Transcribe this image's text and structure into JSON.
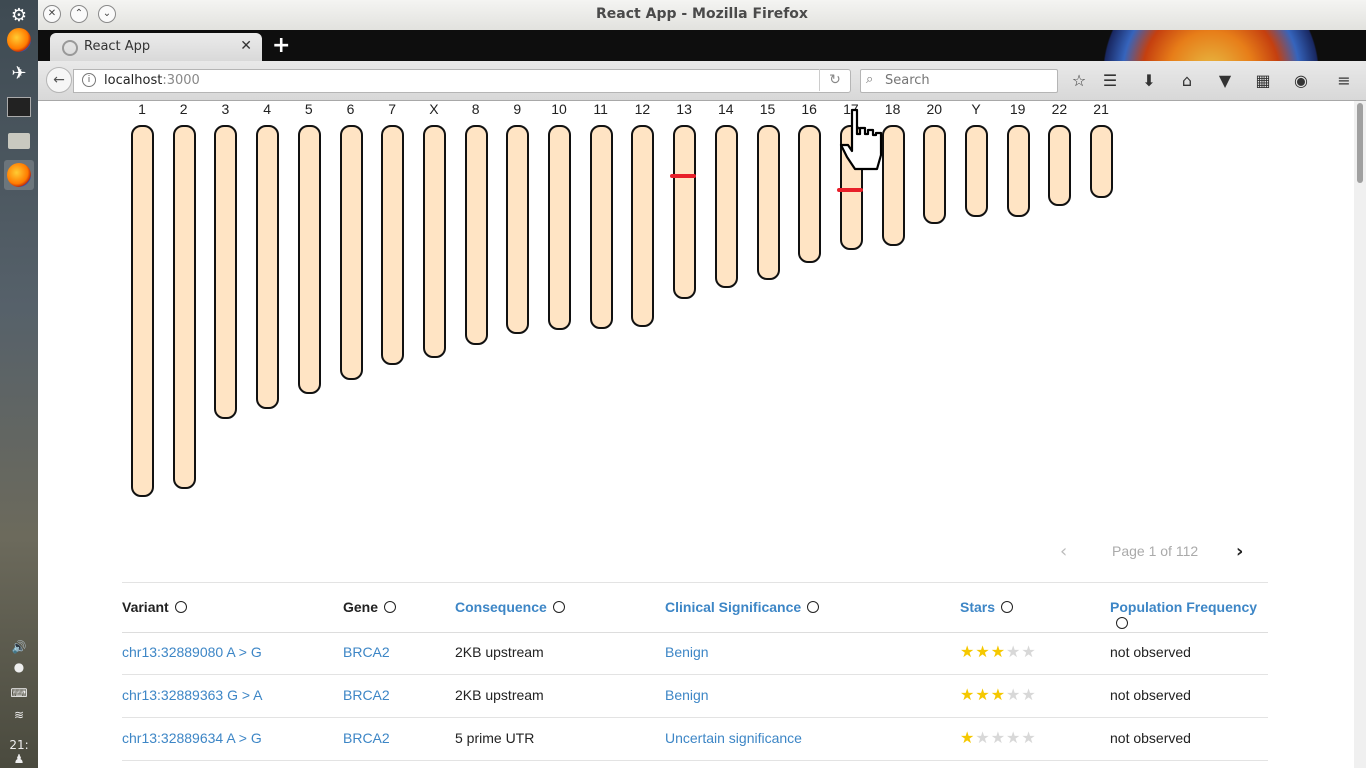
{
  "window": {
    "title": "React App - Mozilla Firefox"
  },
  "tab": {
    "label": "React App"
  },
  "address": {
    "host": "localhost",
    "port": ":3000"
  },
  "search": {
    "placeholder": "Search"
  },
  "system": {
    "clock": "21:"
  },
  "ideogram": {
    "chromosomes": [
      {
        "label": "1",
        "rel": 1.0
      },
      {
        "label": "2",
        "rel": 0.977
      },
      {
        "label": "3",
        "rel": 0.789
      },
      {
        "label": "4",
        "rel": 0.762
      },
      {
        "label": "5",
        "rel": 0.721
      },
      {
        "label": "6",
        "rel": 0.683
      },
      {
        "label": "7",
        "rel": 0.64
      },
      {
        "label": "X",
        "rel": 0.623
      },
      {
        "label": "8",
        "rel": 0.586
      },
      {
        "label": "9",
        "rel": 0.556
      },
      {
        "label": "10",
        "rel": 0.545
      },
      {
        "label": "11",
        "rel": 0.543
      },
      {
        "label": "12",
        "rel": 0.537
      },
      {
        "label": "13",
        "rel": 0.463,
        "mark": 0.29
      },
      {
        "label": "14",
        "rel": 0.431
      },
      {
        "label": "15",
        "rel": 0.409
      },
      {
        "label": "16",
        "rel": 0.365
      },
      {
        "label": "17",
        "rel": 0.328,
        "mark": 0.52
      },
      {
        "label": "18",
        "rel": 0.317
      },
      {
        "label": "20",
        "rel": 0.257
      },
      {
        "label": "Y",
        "rel": 0.24
      },
      {
        "label": "19",
        "rel": 0.238
      },
      {
        "label": "22",
        "rel": 0.208
      },
      {
        "label": "21",
        "rel": 0.188
      }
    ]
  },
  "pagination": {
    "text": "Page 1 of 112"
  },
  "table": {
    "headers": [
      "Variant",
      "Gene",
      "Consequence",
      "Clinical Significance",
      "Stars",
      "Population Frequency"
    ],
    "rows": [
      {
        "variant": "chr13:32889080 A > G",
        "gene": "BRCA2",
        "consequence": "2KB upstream",
        "significance": "Benign",
        "stars": 3,
        "frequency": "not observed"
      },
      {
        "variant": "chr13:32889363 G > A",
        "gene": "BRCA2",
        "consequence": "2KB upstream",
        "significance": "Benign",
        "stars": 3,
        "frequency": "not observed"
      },
      {
        "variant": "chr13:32889634 A > G",
        "gene": "BRCA2",
        "consequence": "5 prime UTR",
        "significance": "Uncertain significance",
        "stars": 1,
        "frequency": "not observed"
      }
    ]
  },
  "colors": {
    "accent": "#3d86c6",
    "chromosome_fill": "#ffe4c4",
    "variant_mark": "#e8202a",
    "star": "#f5c800"
  }
}
